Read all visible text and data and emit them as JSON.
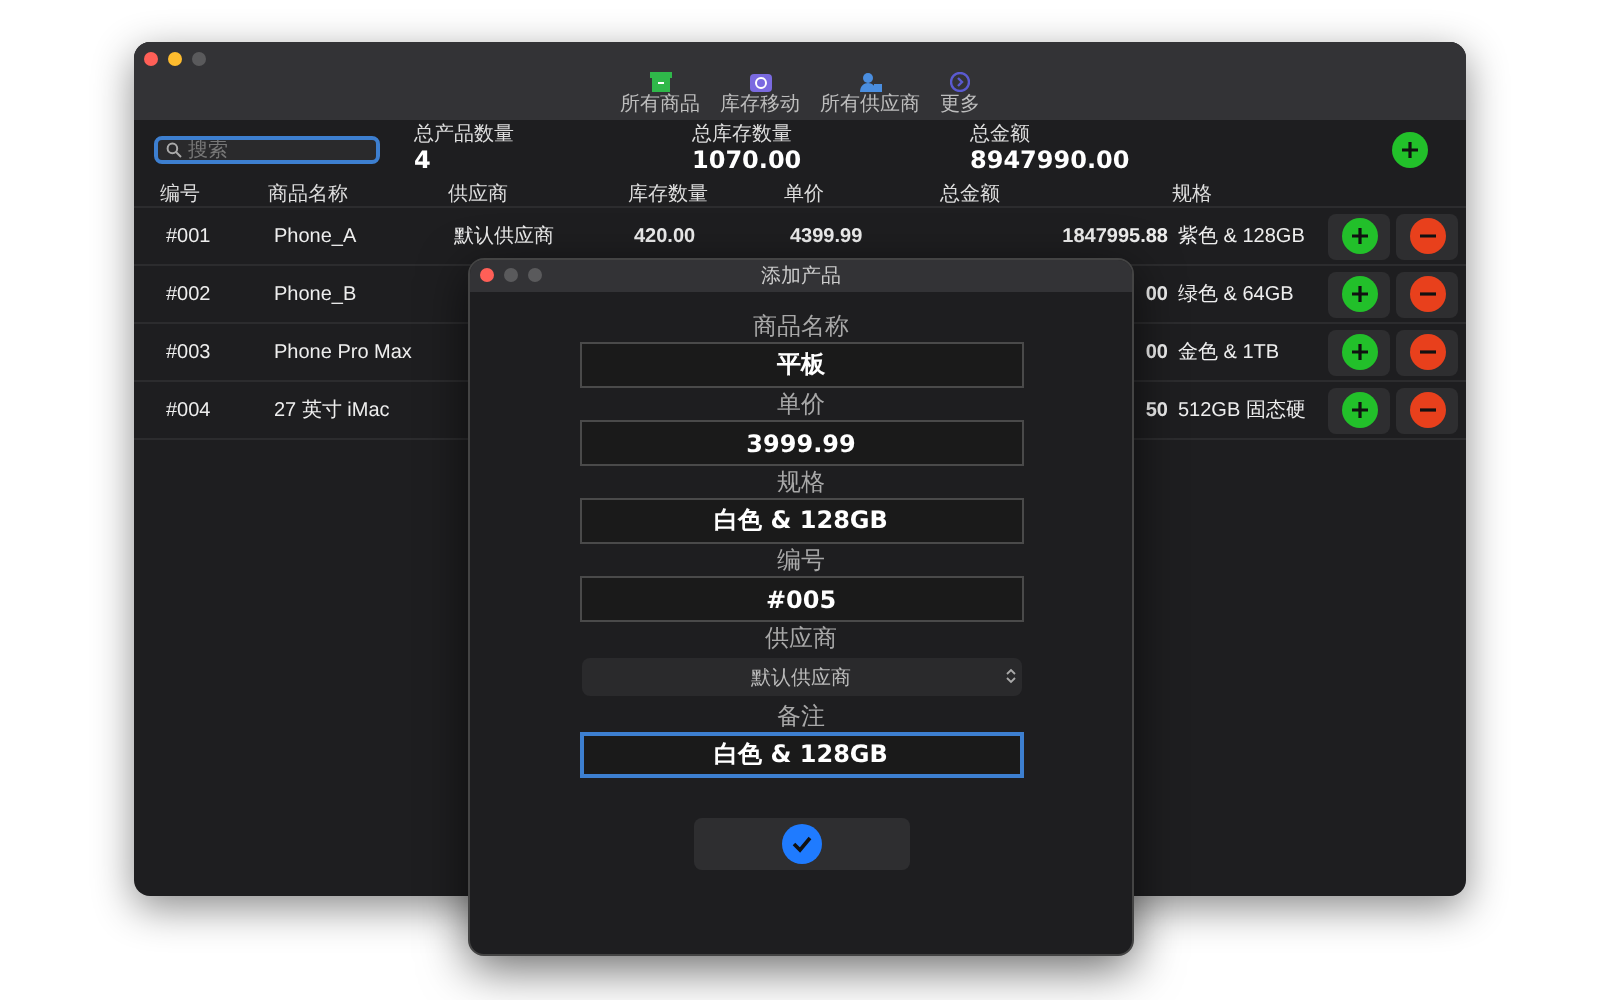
{
  "toolbar": [
    {
      "label": "所有商品"
    },
    {
      "label": "库存移动"
    },
    {
      "label": "所有供应商"
    },
    {
      "label": "更多"
    }
  ],
  "search": {
    "placeholder": "搜索"
  },
  "stats": [
    {
      "label": "总产品数量",
      "value": "4"
    },
    {
      "label": "总库存数量",
      "value": "1070.00"
    },
    {
      "label": "总金额",
      "value": "8947990.00"
    }
  ],
  "columns": [
    "编号",
    "商品名称",
    "供应商",
    "库存数量",
    "单价",
    "总金额",
    "规格"
  ],
  "rows": [
    {
      "id": "#001",
      "name": "Phone_A",
      "supplier": "默认供应商",
      "stock": "420.00",
      "price": "4399.99",
      "total": "1847995.88",
      "spec": "紫色 & 128GB"
    },
    {
      "id": "#002",
      "name": "Phone_B",
      "total": "00",
      "spec": "绿色 & 64GB"
    },
    {
      "id": "#003",
      "name": "Phone Pro Max",
      "total": "00",
      "spec": "金色 & 1TB"
    },
    {
      "id": "#004",
      "name": "27 英寸 iMac",
      "total": "50",
      "spec": "512GB 固态硬"
    }
  ],
  "dialog": {
    "title": "添加产品",
    "fields": [
      {
        "kind": "text",
        "label": "商品名称",
        "value": "平板",
        "focused": false
      },
      {
        "kind": "text",
        "label": "单价",
        "value": "3999.99",
        "focused": false
      },
      {
        "kind": "text",
        "label": "规格",
        "value": "白色 & 128GB",
        "focused": false
      },
      {
        "kind": "text",
        "label": "编号",
        "value": "#005",
        "focused": false
      },
      {
        "kind": "select",
        "label": "供应商",
        "value": "默认供应商"
      },
      {
        "kind": "text",
        "label": "备注",
        "value": "白色 & 128GB",
        "focused": true
      }
    ]
  }
}
